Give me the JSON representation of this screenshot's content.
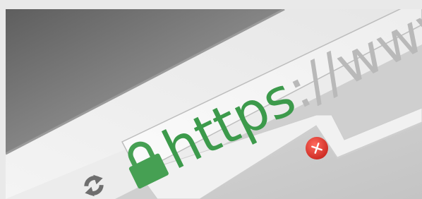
{
  "address_bar": {
    "protocol": "https",
    "separator": "://",
    "host_partial": "www",
    "protocol_color": "#3c9a4b",
    "host_color": "#b9b9b9",
    "lock_color": "#46a053"
  },
  "tab": {
    "close_icon": "close-icon",
    "close_color": "#e43b34"
  },
  "toolbar": {
    "reload_icon": "reload-icon"
  }
}
